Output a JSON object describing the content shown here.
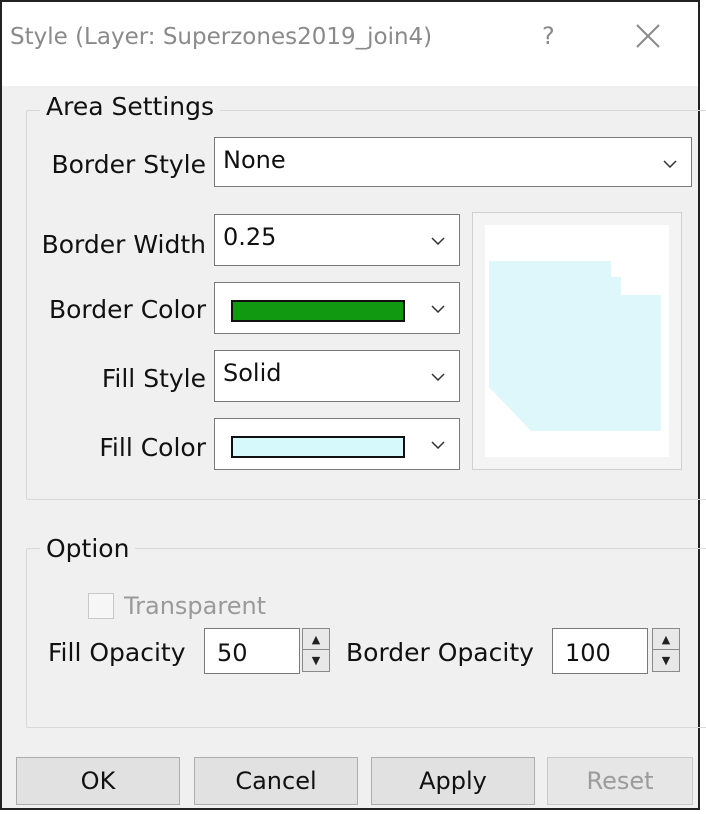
{
  "window": {
    "title": "Style (Layer: Superzones2019_join4)",
    "help_glyph": "?",
    "close_icon": "close-icon"
  },
  "area_settings": {
    "legend": "Area Settings",
    "border_style": {
      "label": "Border Style",
      "value": "None"
    },
    "border_width": {
      "label": "Border Width",
      "value": "0.25"
    },
    "border_color": {
      "label": "Border Color",
      "color": "#119911"
    },
    "fill_style": {
      "label": "Fill Style",
      "value": "Solid"
    },
    "fill_color": {
      "label": "Fill Color",
      "color": "#d6fafc"
    },
    "preview": {
      "shape_fill": "#ddf7fb",
      "shape_fill_opacity": 0.5
    }
  },
  "option": {
    "legend": "Option",
    "transparent": {
      "label": "Transparent",
      "checked": false,
      "enabled": false
    },
    "fill_opacity": {
      "label": "Fill Opacity",
      "value": "50"
    },
    "border_opacity": {
      "label": "Border Opacity",
      "value": "100"
    }
  },
  "buttons": {
    "ok": "OK",
    "cancel": "Cancel",
    "apply": "Apply",
    "reset": "Reset"
  }
}
